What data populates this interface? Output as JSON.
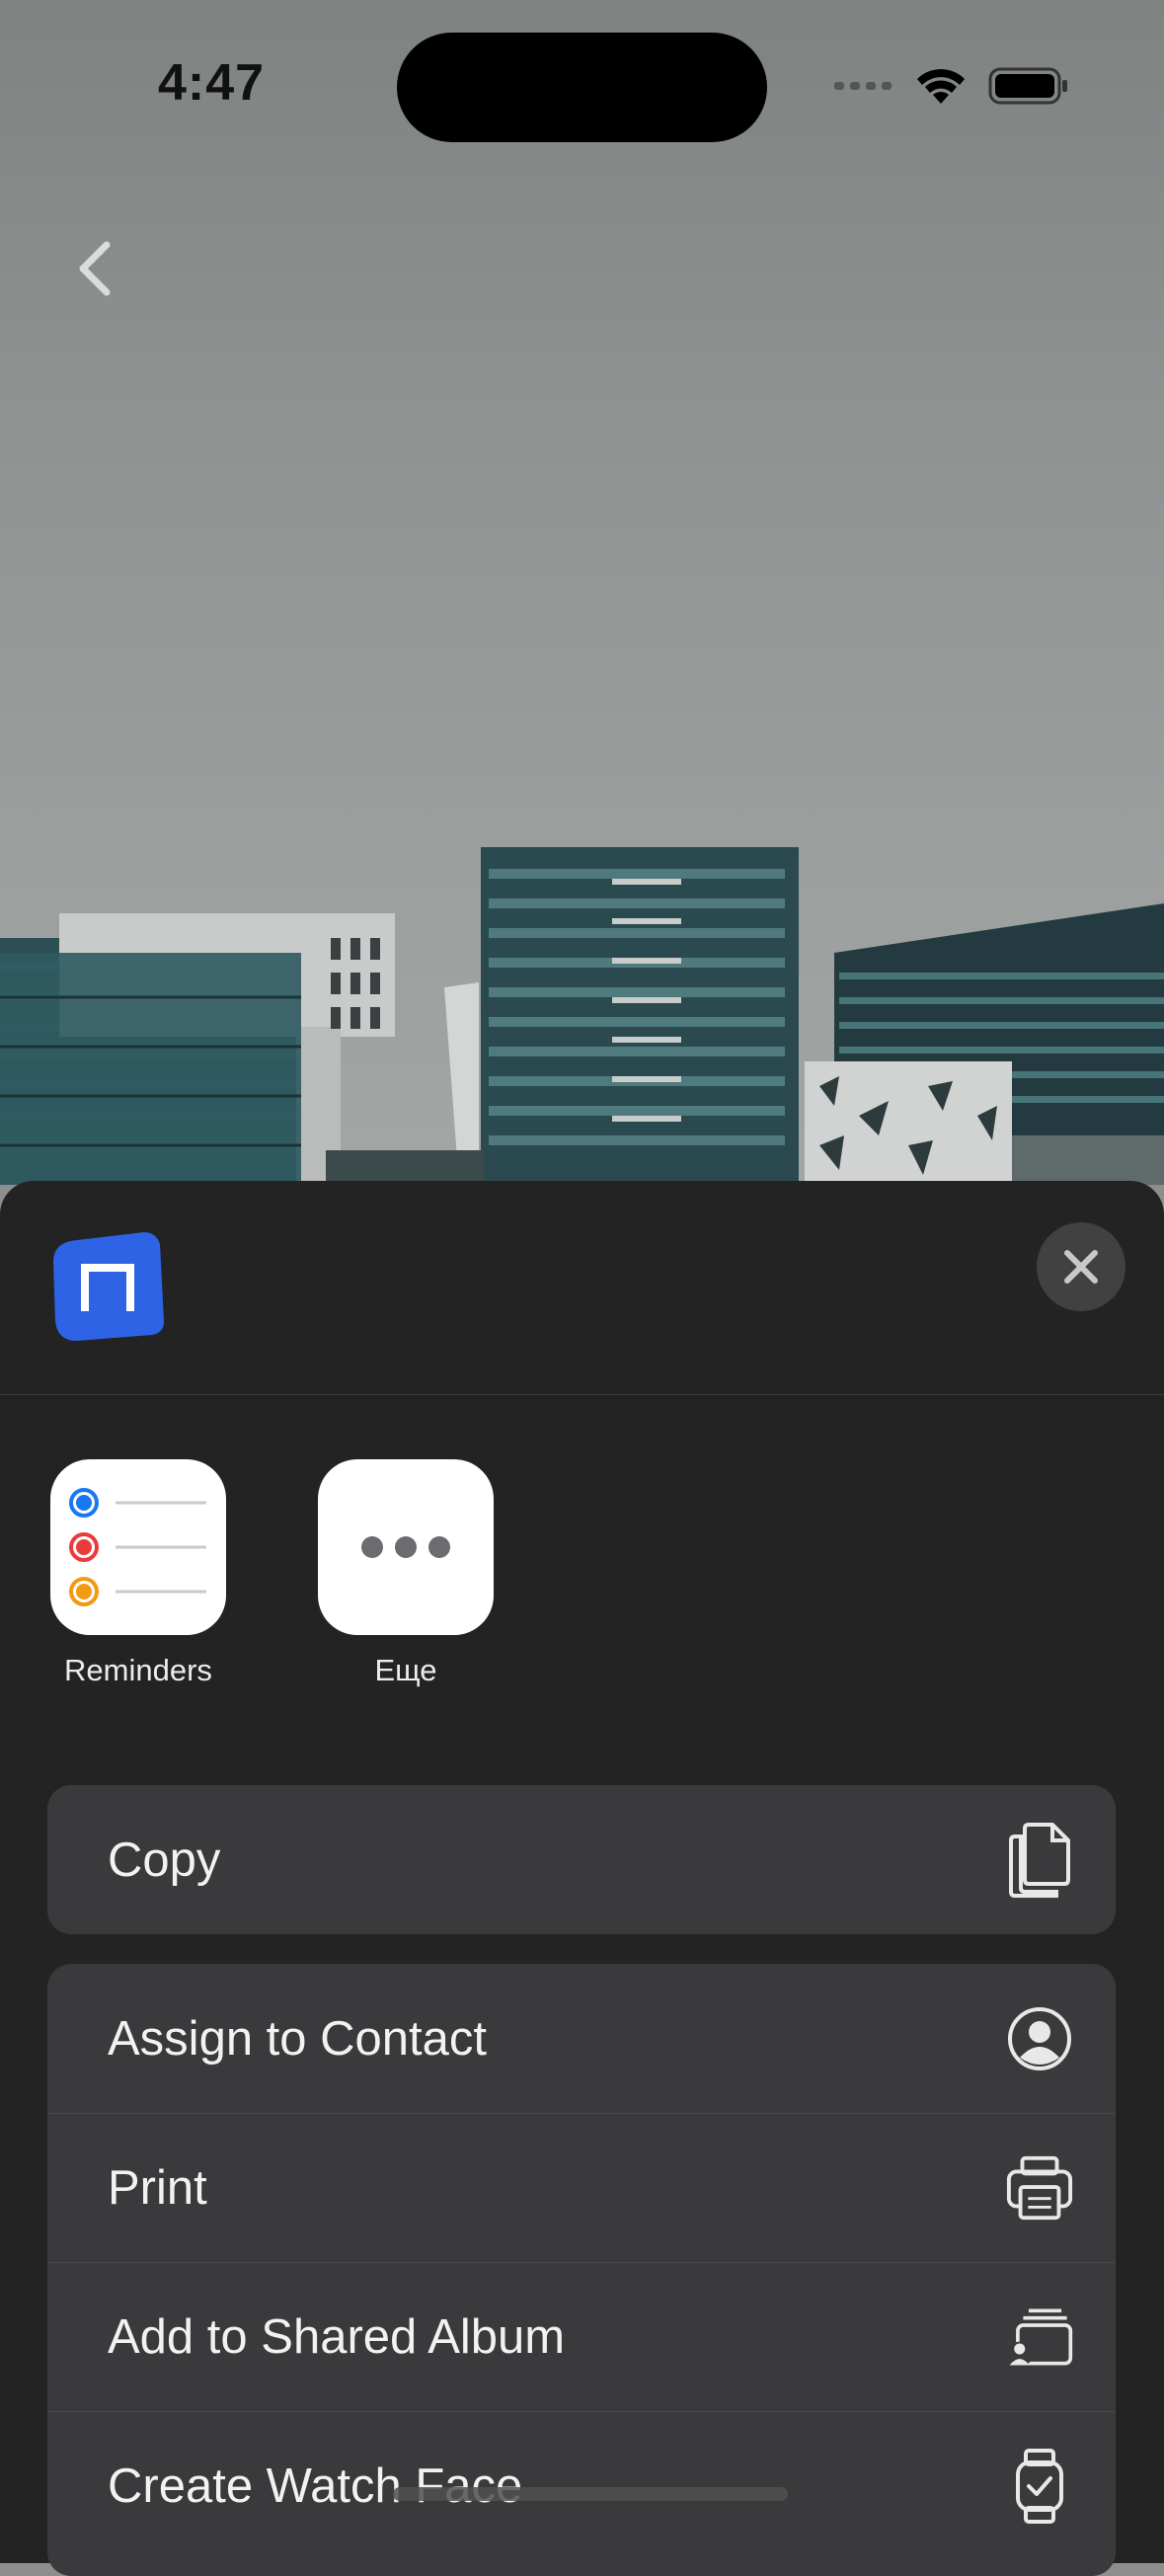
{
  "status_bar": {
    "time": "4:47"
  },
  "apps": [
    {
      "label": "Reminders",
      "icon": "reminders-icon"
    },
    {
      "label": "Еще",
      "icon": "more-icon"
    }
  ],
  "actions": {
    "copy": {
      "label": "Copy",
      "icon": "copy-icon"
    },
    "assign_contact": {
      "label": "Assign to Contact",
      "icon": "contact-icon"
    },
    "print": {
      "label": "Print",
      "icon": "printer-icon"
    },
    "shared_album": {
      "label": "Add to Shared Album",
      "icon": "shared-album-icon"
    },
    "watch_face": {
      "label": "Create Watch Face",
      "icon": "watch-icon"
    }
  },
  "colors": {
    "sheet_bg": "#232323",
    "row_bg": "#3a3a3c",
    "app_logo_blue": "#2f63e6"
  }
}
